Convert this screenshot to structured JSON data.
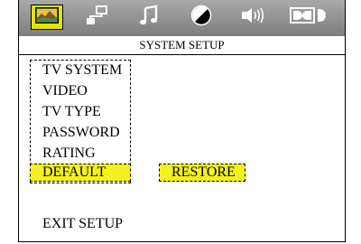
{
  "header": {
    "tabs": [
      {
        "name": "picture-tab",
        "icon": "landscape-picture-icon",
        "selected": true
      },
      {
        "name": "network-tab",
        "icon": "computer-network-icon"
      },
      {
        "name": "audio-tab",
        "icon": "music-note-icon"
      },
      {
        "name": "video-tab",
        "icon": "contrast-circle-icon"
      },
      {
        "name": "speaker-tab",
        "icon": "speaker-icon"
      },
      {
        "name": "dolby-tab",
        "icon": "dolby-logo-icon"
      }
    ],
    "title": "SYSTEM SETUP"
  },
  "menu": {
    "items": [
      {
        "label": "TV SYSTEM"
      },
      {
        "label": "VIDEO"
      },
      {
        "label": "TV TYPE"
      },
      {
        "label": "PASSWORD"
      },
      {
        "label": "RATING"
      },
      {
        "label": "DEFAULT",
        "highlighted": true
      }
    ],
    "submenu": {
      "label": "RESTORE",
      "highlighted": true
    },
    "exit_label": "EXIT SETUP"
  },
  "colors": {
    "highlight": "#f5f01f",
    "selected_tab": "#e9e200",
    "header_gradient_top": "#a9a9a9",
    "header_gradient_bottom": "#7d7d7d"
  }
}
